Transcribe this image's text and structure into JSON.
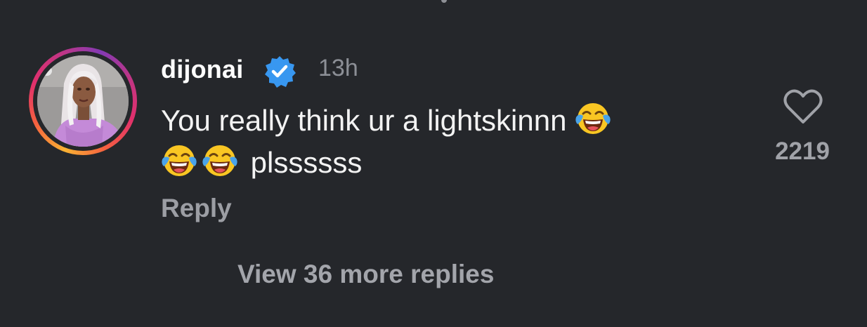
{
  "comment": {
    "username": "dijonai",
    "verified": true,
    "timestamp": "13h",
    "text_line1": "You really think ur a lightskinnn",
    "text_line2": "plssssss",
    "emoji": "face-with-tears-of-joy",
    "reply_label": "Reply",
    "like_count": "2219"
  },
  "thread": {
    "view_more_label": "View 36 more replies"
  },
  "colors": {
    "background": "#25272b",
    "verified_badge": "#3897f0",
    "muted_text": "#8c8f96"
  }
}
